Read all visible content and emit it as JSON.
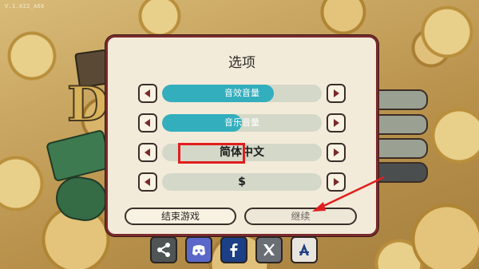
{
  "version": "V.1.022_A66",
  "background": {
    "logo_letter": "D"
  },
  "dialog": {
    "title": "选项",
    "sound_volume": {
      "label": "音效音量",
      "level": 0.7
    },
    "music_volume": {
      "label": "音乐音量",
      "level": 0.5
    },
    "language": {
      "value": "简体中文"
    },
    "currency": {
      "value": "$"
    },
    "end_game_label": "结束游戏",
    "continue_label": "继续"
  },
  "socials": [
    {
      "name": "share-icon",
      "color": "#4f5555"
    },
    {
      "name": "discord-icon",
      "color": "#5b68c9"
    },
    {
      "name": "facebook-icon",
      "color": "#1d3f86"
    },
    {
      "name": "x-icon",
      "color": "#6a6f75"
    },
    {
      "name": "app-store-icon",
      "color": "#e8e5df"
    }
  ],
  "colors": {
    "panel_border": "#7a2a2c",
    "slider_fill": "#33aebd",
    "highlight": "#e01e1e"
  }
}
